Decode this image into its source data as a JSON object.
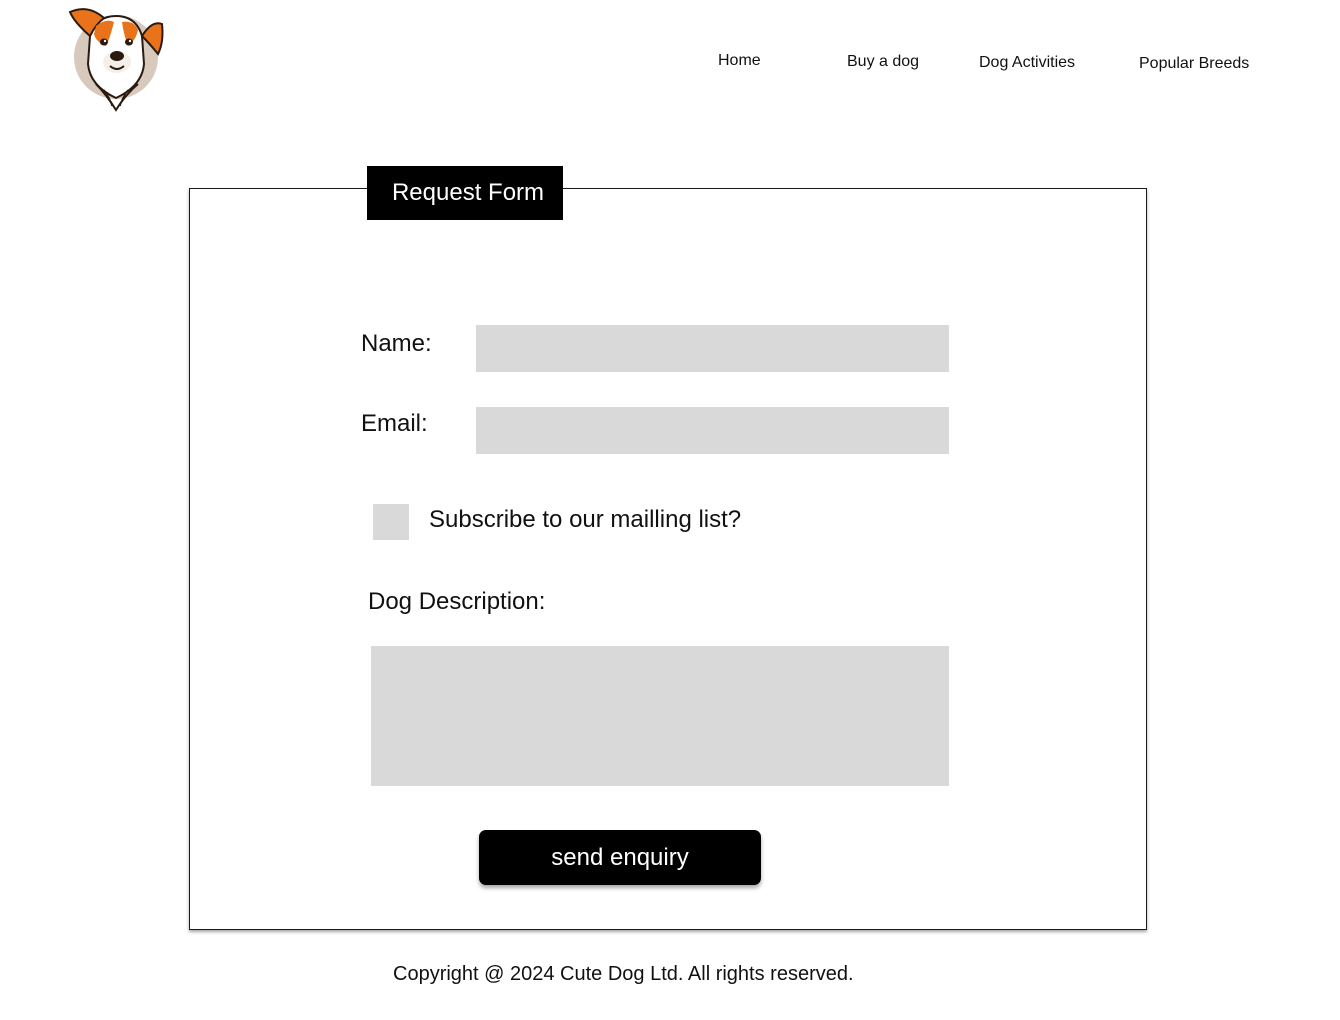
{
  "header": {
    "logo_icon": "dog-head-icon",
    "nav": {
      "home": "Home",
      "buy": "Buy a dog",
      "activities": "Dog Activities",
      "breeds": "Popular Breeds"
    }
  },
  "form": {
    "title": "Request Form",
    "name_label": "Name:",
    "name_value": "",
    "email_label": "Email:",
    "email_value": "",
    "subscribe_label": "Subscribe to our mailling list?",
    "subscribe_checked": false,
    "description_label": "Dog Description:",
    "description_value": "",
    "submit_label": "send enquiry"
  },
  "footer": {
    "copyright": "Copyright @ 2024 Cute Dog Ltd. All rights reserved."
  },
  "colors": {
    "field_background": "#d9d9d9",
    "button_background": "#000000",
    "logo_orange": "#e8731a",
    "logo_circle": "#d8c9bd"
  }
}
